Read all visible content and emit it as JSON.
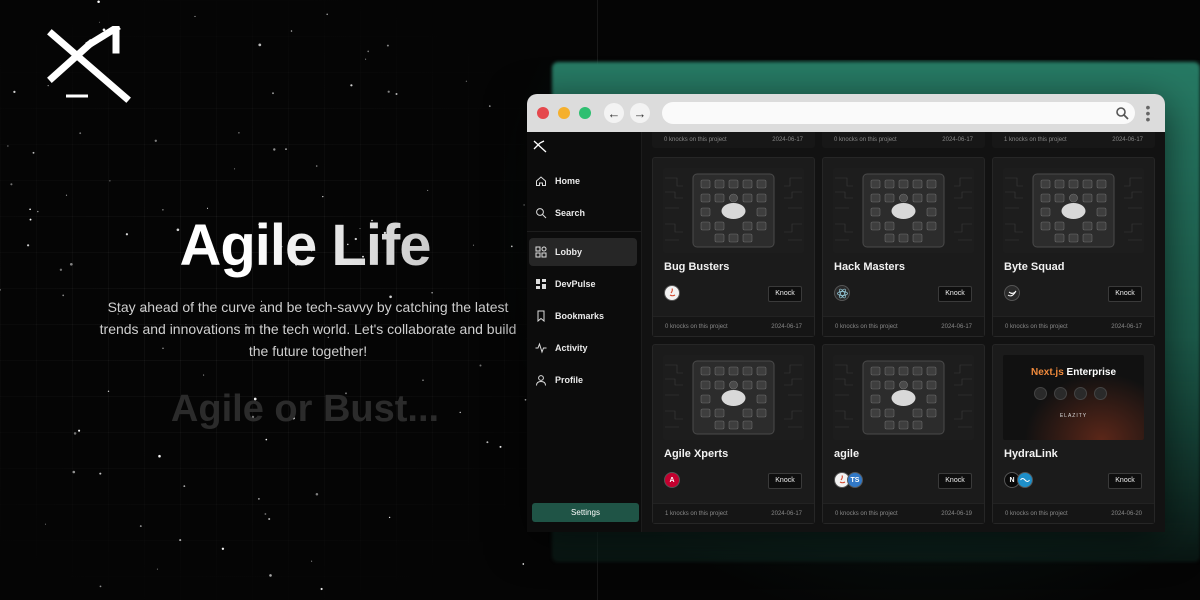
{
  "hero": {
    "title": "Agile Life",
    "description": "Stay ahead of the curve and be tech-savvy by catching the latest trends and innovations in the tech world. Let's collaborate and build the future together!",
    "tagline": "Agile or Bust..."
  },
  "browser": {
    "dots": [
      "#e5484d",
      "#f5b02d",
      "#2fbf71"
    ],
    "back_icon": "arrow-left-icon",
    "forward_icon": "arrow-right-icon",
    "url": ""
  },
  "sidebar": {
    "items": [
      {
        "label": "Home",
        "icon": "home-icon"
      },
      {
        "label": "Search",
        "icon": "search-icon"
      },
      {
        "label": "Lobby",
        "icon": "grid-icon",
        "active": true
      },
      {
        "label": "DevPulse",
        "icon": "dashboard-icon"
      },
      {
        "label": "Bookmarks",
        "icon": "bookmark-icon"
      },
      {
        "label": "Activity",
        "icon": "activity-icon"
      },
      {
        "label": "Profile",
        "icon": "user-icon"
      }
    ],
    "settings_label": "Settings"
  },
  "top_strips": [
    {
      "knocks": "0",
      "text": "knocks on this project",
      "date": "2024-06-17"
    },
    {
      "knocks": "0",
      "text": "knocks on this project",
      "date": "2024-06-17"
    },
    {
      "knocks": "1",
      "text": "knocks on this project",
      "date": "2024-06-17"
    }
  ],
  "projects": [
    {
      "name": "Bug Busters",
      "badges": [
        "java-icon"
      ],
      "knock_label": "Knock",
      "knocks": "0",
      "knocks_text": "knocks on this project",
      "date": "2024-06-17"
    },
    {
      "name": "Hack Masters",
      "badges": [
        "react-icon"
      ],
      "knock_label": "Knock",
      "knocks": "0",
      "knocks_text": "knocks on this project",
      "date": "2024-06-17"
    },
    {
      "name": "Byte Squad",
      "badges": [
        "swift-icon"
      ],
      "knock_label": "Knock",
      "knocks": "0",
      "knocks_text": "knocks on this project",
      "date": "2024-06-17"
    },
    {
      "name": "Agile Xperts",
      "badges": [
        "angular-icon"
      ],
      "knock_label": "Knock",
      "knocks": "1",
      "knocks_text": "knocks on this project",
      "date": "2024-06-17"
    },
    {
      "name": "agile",
      "badges": [
        "java-icon",
        "typescript-icon"
      ],
      "knock_label": "Knock",
      "knocks": "0",
      "knocks_text": "knocks on this project",
      "date": "2024-06-19"
    },
    {
      "name": "HydraLink",
      "badges": [
        "nextjs-icon",
        "tailwind-icon"
      ],
      "knock_label": "Knock",
      "knocks": "0",
      "knocks_text": "knocks on this project",
      "date": "2024-06-20"
    }
  ],
  "nextjs_thumb": {
    "accent": "Next.js",
    "rest": "Enterprise",
    "brand": "ELAZITY"
  },
  "badge_text": {
    "typescript-icon": "TS",
    "angular-icon": "A",
    "nextjs-icon": "N"
  },
  "colors": {
    "accent": "#1f5446",
    "glow": "#277a64"
  }
}
